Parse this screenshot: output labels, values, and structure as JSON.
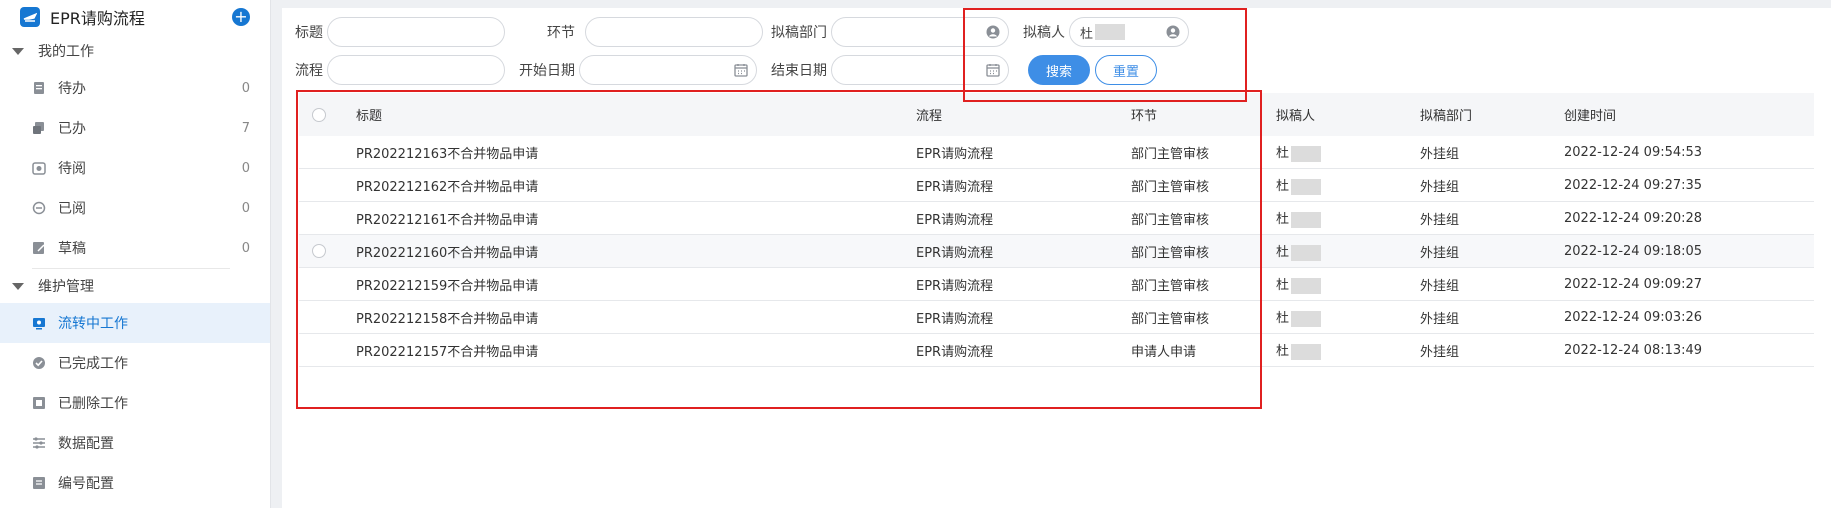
{
  "app": {
    "title": "EPR请购流程"
  },
  "sidebar": {
    "groups": [
      {
        "label": "我的工作",
        "items": [
          {
            "label": "待办",
            "count": "0",
            "icon": "todo-icon"
          },
          {
            "label": "已办",
            "count": "7",
            "icon": "done-icon"
          },
          {
            "label": "待阅",
            "count": "0",
            "icon": "to-read-icon"
          },
          {
            "label": "已阅",
            "count": "0",
            "icon": "read-icon"
          },
          {
            "label": "草稿",
            "count": "0",
            "icon": "draft-icon"
          }
        ]
      },
      {
        "label": "维护管理",
        "items": [
          {
            "label": "流转中工作",
            "icon": "in-progress-icon",
            "active": true
          },
          {
            "label": "已完成工作",
            "icon": "completed-icon"
          },
          {
            "label": "已删除工作",
            "icon": "deleted-icon"
          },
          {
            "label": "数据配置",
            "icon": "data-config-icon"
          },
          {
            "label": "编号配置",
            "icon": "number-config-icon"
          }
        ]
      }
    ]
  },
  "filters": {
    "title_label": "标题",
    "step_label": "环节",
    "dept_label": "拟稿部门",
    "author_label": "拟稿人",
    "author_value": "杜",
    "flow_label": "流程",
    "start_label": "开始日期",
    "end_label": "结束日期",
    "search_btn": "搜索",
    "reset_btn": "重置"
  },
  "table": {
    "headers": {
      "title": "标题",
      "flow": "流程",
      "step": "环节",
      "author": "拟稿人",
      "dept": "拟稿部门",
      "time": "创建时间"
    },
    "rows": [
      {
        "title": "PR202212163不合并物品申请",
        "flow": "EPR请购流程",
        "step": "部门主管审核",
        "author": "杜",
        "dept": "外挂组",
        "time": "2022-12-24 09:54:53"
      },
      {
        "title": "PR202212162不合并物品申请",
        "flow": "EPR请购流程",
        "step": "部门主管审核",
        "author": "杜",
        "dept": "外挂组",
        "time": "2022-12-24 09:27:35"
      },
      {
        "title": "PR202212161不合并物品申请",
        "flow": "EPR请购流程",
        "step": "部门主管审核",
        "author": "杜",
        "dept": "外挂组",
        "time": "2022-12-24 09:20:28"
      },
      {
        "title": "PR202212160不合并物品申请",
        "flow": "EPR请购流程",
        "step": "部门主管审核",
        "author": "杜",
        "dept": "外挂组",
        "time": "2022-12-24 09:18:05"
      },
      {
        "title": "PR202212159不合并物品申请",
        "flow": "EPR请购流程",
        "step": "部门主管审核",
        "author": "杜",
        "dept": "外挂组",
        "time": "2022-12-24 09:09:27"
      },
      {
        "title": "PR202212158不合并物品申请",
        "flow": "EPR请购流程",
        "step": "部门主管审核",
        "author": "杜",
        "dept": "外挂组",
        "time": "2022-12-24 09:03:26"
      },
      {
        "title": "PR202212157不合并物品申请",
        "flow": "EPR请购流程",
        "step": "申请人申请",
        "author": "杜",
        "dept": "外挂组",
        "time": "2022-12-24 08:13:49"
      }
    ]
  },
  "colors": {
    "accent": "#1677d2",
    "button": "#3e8ee6",
    "annotation": "#e02020"
  }
}
